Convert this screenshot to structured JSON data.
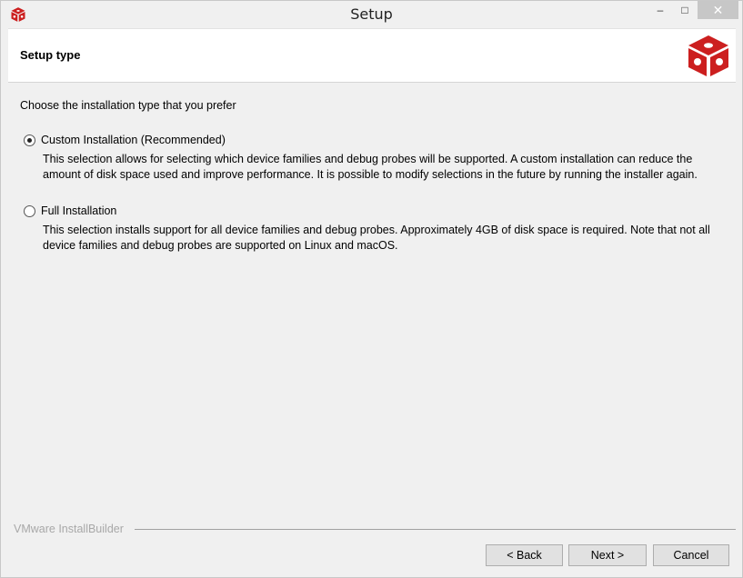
{
  "window": {
    "title": "Setup"
  },
  "header": {
    "title": "Setup type"
  },
  "content": {
    "prompt": "Choose the installation type that you prefer",
    "options": [
      {
        "label": "Custom Installation (Recommended)",
        "selected": true,
        "description": "This selection allows for selecting which device families and debug probes will be supported.  A custom installation can reduce the amount of disk space used and improve performance.  It is possible to modify selections in the future by running the installer again."
      },
      {
        "label": "Full Installation",
        "selected": false,
        "description": "This selection installs support for all device families and debug probes.  Approximately 4GB of disk space is required.  Note that not all device families and debug probes are supported on Linux and macOS."
      }
    ]
  },
  "footer": {
    "brand": "VMware InstallBuilder"
  },
  "buttons": {
    "back": "< Back",
    "next": "Next >",
    "cancel": "Cancel"
  },
  "icons": {
    "app": "red-cube-icon",
    "logo": "red-cube-logo-icon",
    "minimize": "minimize-icon",
    "maximize": "maximize-icon",
    "close": "close-icon"
  },
  "colors": {
    "brand_red": "#cc1f1f",
    "close_button": "#c7c7c7"
  }
}
